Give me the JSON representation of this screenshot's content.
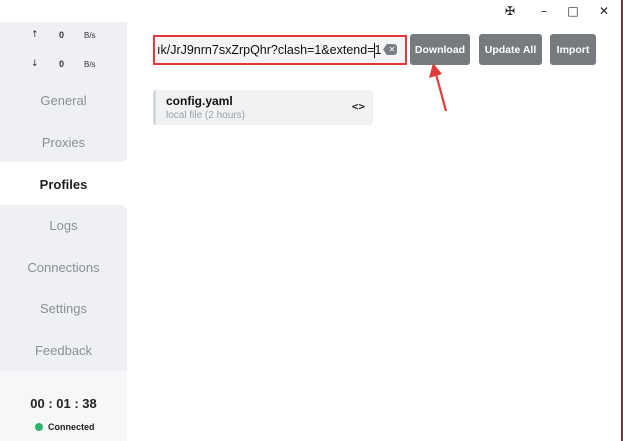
{
  "window_controls": {
    "pin_icon": "✠",
    "minimize_icon": "–",
    "maximize_icon": "□",
    "close_icon": "✕"
  },
  "traffic": {
    "up": {
      "arrow": "↑",
      "value": "0",
      "unit": "B/s"
    },
    "down": {
      "arrow": "↓",
      "value": "0",
      "unit": "B/s"
    }
  },
  "nav": {
    "items": [
      {
        "label": "General"
      },
      {
        "label": "Proxies"
      },
      {
        "label": "Profiles"
      },
      {
        "label": "Logs"
      },
      {
        "label": "Connections"
      },
      {
        "label": "Settings"
      },
      {
        "label": "Feedback"
      }
    ],
    "active": "Profiles"
  },
  "clock": "00 : 01 : 38",
  "status": {
    "label": "Connected",
    "color": "#2db66b"
  },
  "url_input": {
    "value": "ık/JrJ9nrn7sxZrpQhr?clash=1&extend=1",
    "clear_icon": "✕"
  },
  "buttons": {
    "download": "Download",
    "update_all": "Update All",
    "import": "Import"
  },
  "profile_card": {
    "name": "config.yaml",
    "subtitle": "local file (2 hours)",
    "edit_icon": "<>"
  },
  "colors": {
    "highlight_box": "#e23a3a",
    "annotation_arrow": "#e23a3a",
    "button_bg": "#777b80"
  }
}
